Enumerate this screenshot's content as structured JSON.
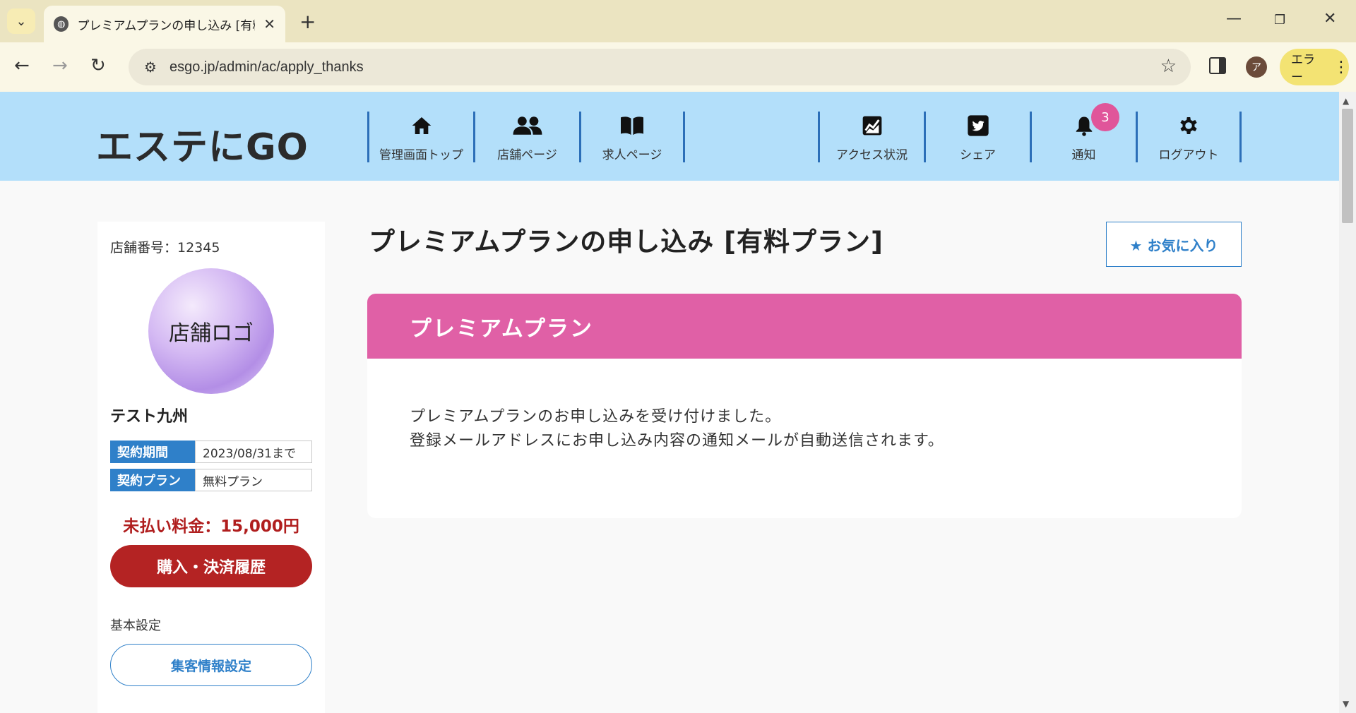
{
  "browser": {
    "tab_title": "プレミアムプランの申し込み [有料プ",
    "url": "esgo.jp/admin/ac/apply_thanks",
    "profile_initial": "ア",
    "error_label": "エラー"
  },
  "header": {
    "logo": "エステにGO",
    "nav": [
      {
        "label": "管理画面トップ",
        "icon": "home-icon"
      },
      {
        "label": "店舗ページ",
        "icon": "people-icon"
      },
      {
        "label": "求人ページ",
        "icon": "book-icon"
      },
      {
        "label": "アクセス状況",
        "icon": "chart-icon"
      },
      {
        "label": "シェア",
        "icon": "twitter-icon"
      },
      {
        "label": "通知",
        "icon": "bell-icon",
        "badge": "3"
      },
      {
        "label": "ログアウト",
        "icon": "gear-icon"
      }
    ]
  },
  "sidebar": {
    "shop_number": "店舗番号：12345",
    "logo_text": "店舗ロゴ",
    "shop_name": "テスト九州",
    "contract_period_label": "契約期間",
    "contract_period_value": "2023/08/31まで",
    "contract_plan_label": "契約プラン",
    "contract_plan_value": "無料プラン",
    "unpaid": "未払い料金：15,000円",
    "history_button": "購入・決済履歴",
    "basic_settings": "基本設定",
    "setting_button": "集客情報設定"
  },
  "main": {
    "title": "プレミアムプランの申し込み [有料プラン]",
    "favorite_button": "★ お気に入り",
    "card_title": "プレミアムプラン",
    "message_line1": "プレミアムプランのお申し込みを受け付けました。",
    "message_line2": "登録メールアドレスにお申し込み内容の通知メールが自動送信されます。"
  },
  "colors": {
    "header_bg": "#b3dffa",
    "accent_blue": "#2f80c9",
    "card_pink": "#e060a6",
    "danger_red": "#b42323"
  }
}
